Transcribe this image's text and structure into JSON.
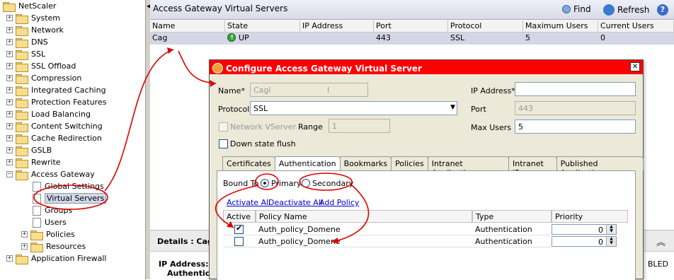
{
  "tree": {
    "root": "NetScaler",
    "items": [
      {
        "label": "System"
      },
      {
        "label": "Network"
      },
      {
        "label": "DNS"
      },
      {
        "label": "SSL"
      },
      {
        "label": "SSL Offload"
      },
      {
        "label": "Compression"
      },
      {
        "label": "Integrated Caching"
      },
      {
        "label": "Protection Features"
      },
      {
        "label": "Load Balancing"
      },
      {
        "label": "Content Switching"
      },
      {
        "label": "Cache Redirection"
      },
      {
        "label": "GSLB"
      },
      {
        "label": "Rewrite"
      },
      {
        "label": "Access Gateway"
      }
    ],
    "ag_children": [
      {
        "label": "Global Settings"
      },
      {
        "label": "Virtual Servers"
      },
      {
        "label": "Groups"
      },
      {
        "label": "Users"
      },
      {
        "label": "Policies"
      },
      {
        "label": "Resources"
      }
    ],
    "last": "Application Firewall"
  },
  "toolbar": {
    "title": "Access Gateway Virtual Servers",
    "find": "Find",
    "refresh": "Refresh",
    "help": "?"
  },
  "grid": {
    "columns": [
      "Name",
      "State",
      "IP Address",
      "Port",
      "Protocol",
      "Maximum Users",
      "Current Users"
    ],
    "rows": [
      {
        "name": "Cag",
        "state": "UP",
        "ip": "",
        "port": "443",
        "protocol": "SSL",
        "max_users": "5",
        "current_users": "0"
      }
    ]
  },
  "details": {
    "header": "Details : CagF",
    "ip_label": "IP Address:",
    "auth_label": "Authentica",
    "right_text": "BLED"
  },
  "dialog": {
    "title": "Configure Access Gateway Virtual Server",
    "close": "✕",
    "name_label": "Name*",
    "name_value": "Cagl",
    "name_cursor": "I",
    "ip_label": "IP Address*",
    "ip_value": "",
    "protocol_label": "Protocol",
    "protocol_value": "SSL",
    "port_label": "Port",
    "port_value": "443",
    "network_vserver_label": "Network VServer",
    "range_label": "Range",
    "range_value": "1",
    "max_users_label": "Max Users",
    "max_users_value": "5",
    "down_state_flush_label": "Down state flush",
    "tabs": [
      "Certificates",
      "Authentication",
      "Bookmarks",
      "Policies",
      "Intranet Applications",
      "Intranet IPs",
      "Published Applications"
    ],
    "active_tab": "Authentication",
    "bound_to_label": "Bound To",
    "primary_label": "Primary",
    "secondary_label": "Secondary",
    "activate_all": "Activate All",
    "deactivate_all": "Deactivate All",
    "add_policy": "Add Policy",
    "policy_columns": [
      "Active",
      "Policy Name",
      "Type",
      "Priority"
    ],
    "policies": [
      {
        "active": true,
        "name": "Auth_policy_Domene",
        "type": "Authentication",
        "priority": "0"
      },
      {
        "active": false,
        "name": "Auth_policy_Domene",
        "type": "Authentication",
        "priority": "0"
      }
    ]
  },
  "colors": {
    "annotation_red": "#e00000",
    "dialog_title_bg": "#ff0000",
    "selected_row": "#d4d6e6"
  }
}
